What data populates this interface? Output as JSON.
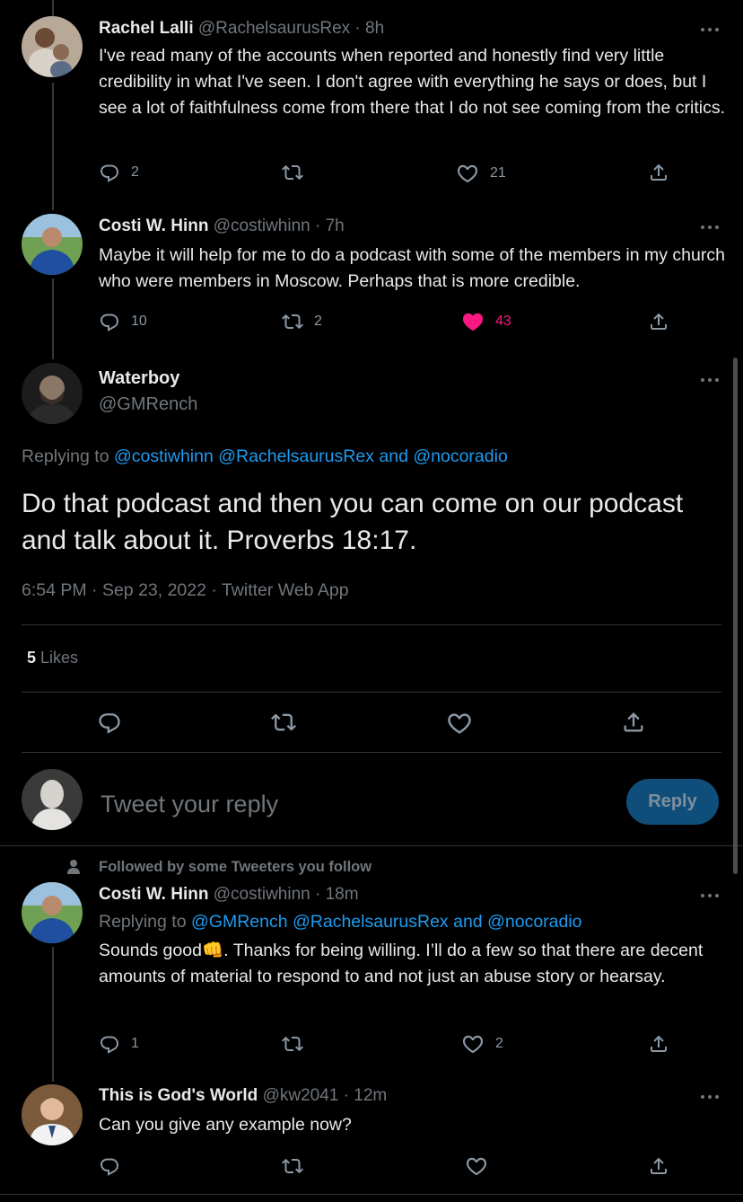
{
  "tweets": {
    "rachel": {
      "name": "Rachel Lalli",
      "handle": "@RachelsaurusRex",
      "time": "· 8h",
      "text": "I've read many of the accounts when reported and honestly find very little credibility in what I've seen. I don't agree with everything he says or does, but I see a lot of faithfulness come from there that I do not see coming from the critics.",
      "replies": "2",
      "retweets": "",
      "likes": "21"
    },
    "costi1": {
      "name": "Costi W. Hinn",
      "handle": "@costiwhinn",
      "time": "· 7h",
      "text": "Maybe it will help for me to do a podcast with some of the members in my church who were members in Moscow. Perhaps that is more credible.",
      "replies": "10",
      "retweets": "2",
      "likes": "43"
    },
    "main": {
      "name": "Waterboy",
      "handle": "@GMRench",
      "replying_prefix": "Replying to",
      "replying_mention1": "@costiwhinn",
      "replying_mention2": "@RachelsaurusRex",
      "replying_and": "and",
      "replying_mention3": "@nocoradio",
      "text": "Do that podcast and then you can come on our podcast and talk about it. Proverbs 18:17.",
      "timestamp": "6:54 PM · Sep 23, 2022 · Twitter Web App",
      "likes_count": "5",
      "likes_label": "Likes"
    },
    "costi2": {
      "social_context": "Followed by some Tweeters you follow",
      "name": "Costi W. Hinn",
      "handle": "@costiwhinn",
      "time": "· 18m",
      "replying_prefix": "Replying to",
      "replying_mention1": "@GMRench",
      "replying_mention2": "@RachelsaurusRex",
      "replying_and": "and",
      "replying_mention3": "@nocoradio",
      "text_before_emoji": "Sounds good",
      "emoji": "👊",
      "text_after_emoji": ". Thanks for being willing. I’ll do a few so that there are decent amounts of material to respond to and not just an abuse story or hearsay.",
      "replies": "1",
      "retweets": "",
      "likes": "2"
    },
    "gods_world": {
      "name": "This is God's World",
      "handle": "@kw2041",
      "time": "· 12m",
      "text": "Can you give any example now?"
    }
  },
  "composer": {
    "placeholder": "Tweet your reply",
    "button": "Reply"
  },
  "colors": {
    "background": "#000000",
    "accent": "#1d9bf0",
    "like": "#f91880",
    "muted": "#71767b"
  }
}
